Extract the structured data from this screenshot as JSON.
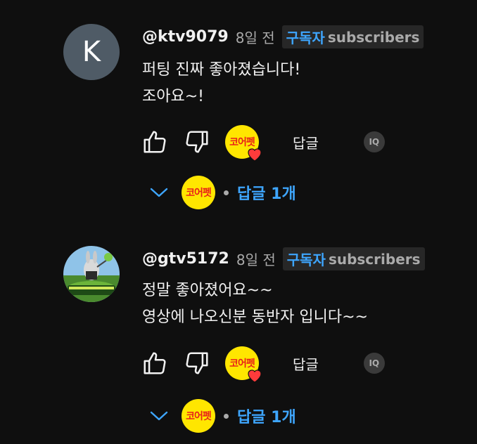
{
  "comments": [
    {
      "avatar_letter": "K",
      "handle": "@ktv9079",
      "time": "8일 전",
      "badge_ko": "구독자",
      "badge_en": "subscribers",
      "lines": [
        "퍼팅 진짜 좋아졌습니다!",
        "조아요~!"
      ],
      "creator_logo": "코어펫",
      "reply_label": "답글",
      "translate_label": "IQ",
      "replies_label": "답글 1개"
    },
    {
      "avatar_letter": "",
      "handle": "@gtv5172",
      "time": "8일 전",
      "badge_ko": "구독자",
      "badge_en": "subscribers",
      "lines": [
        "정말 좋아졌어요~~",
        "영상에 나오신분 동반자 입니다~~"
      ],
      "creator_logo": "코어펫",
      "reply_label": "답글",
      "translate_label": "IQ",
      "replies_label": "답글 1개"
    }
  ],
  "colors": {
    "background": "#0f0f0f",
    "accent_blue": "#3ea6ff",
    "logo_yellow": "#ffe600",
    "logo_red": "#e8201a",
    "heart_red": "#ff3b3b"
  },
  "icons": [
    "thumbs-up-icon",
    "thumbs-down-icon",
    "heart-icon",
    "chevron-down-icon"
  ]
}
